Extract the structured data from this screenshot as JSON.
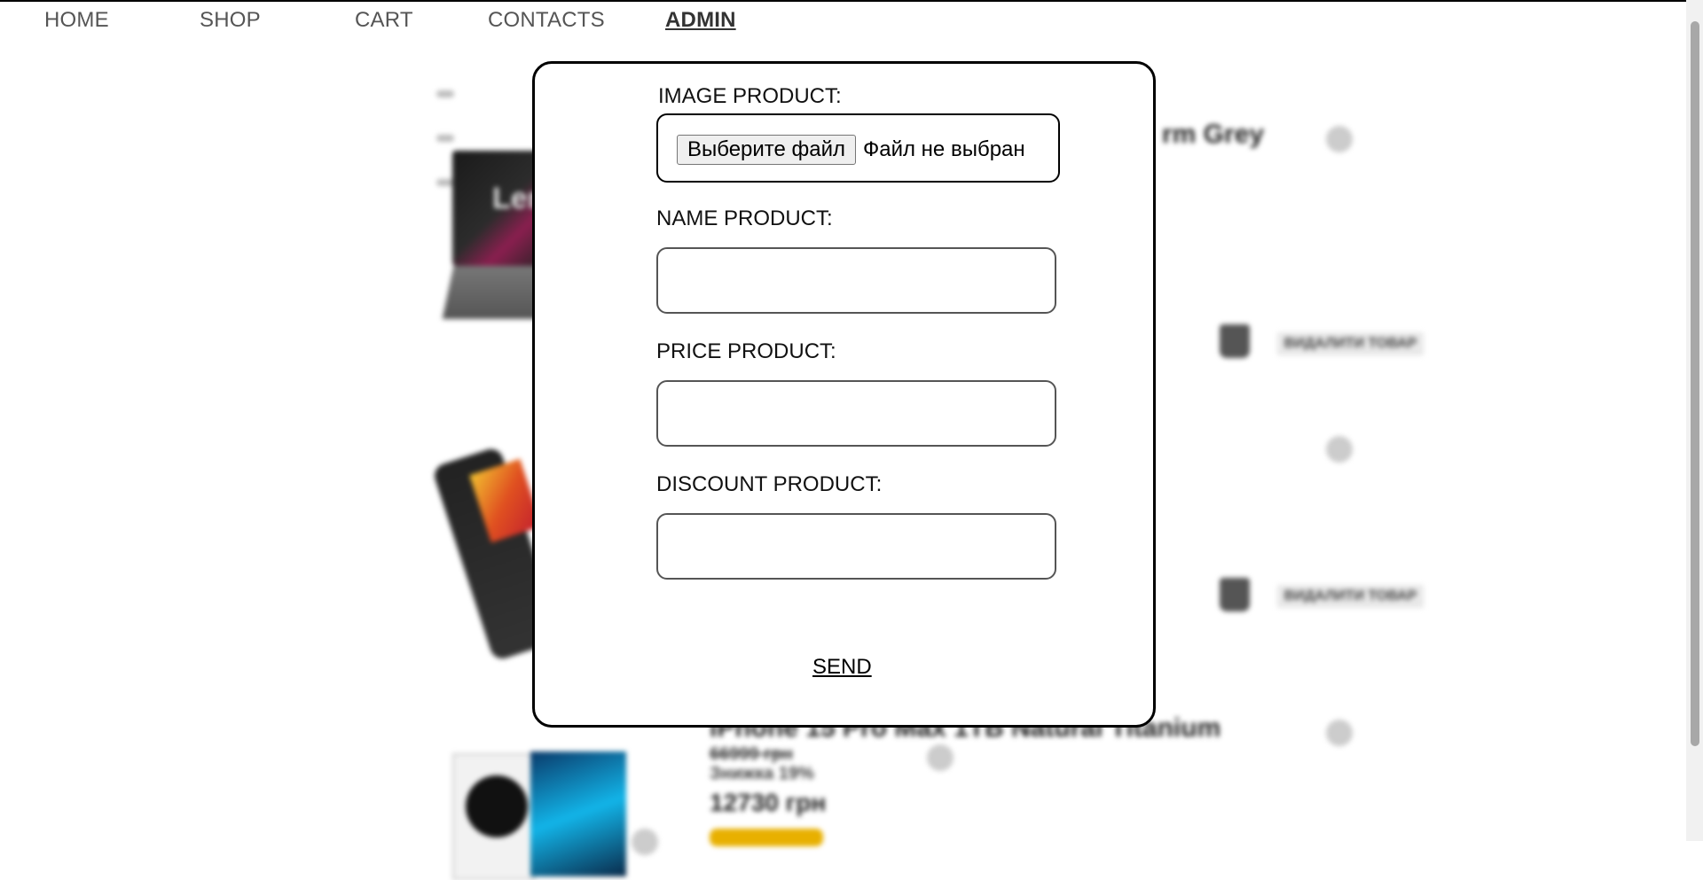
{
  "nav": {
    "home": "HOME",
    "shop": "SHOP",
    "cart": "CART",
    "contacts": "CONTACTS",
    "admin": "ADMIN"
  },
  "background": {
    "product_1_title_fragment": "rm Grey",
    "laptop_brand_fragment": "Ler",
    "product_3_title": "iPhone 15 Pro Max 1TB Natural Titanium",
    "product_3_old_price": "66999 грн",
    "product_3_discount": "Знижка 19%",
    "product_3_price": "12730 грн",
    "delete_label": "ВИДАЛИТИ ТОВАР"
  },
  "form": {
    "image_label": "IMAGE PRODUCT:",
    "file_button": "Выберите файл",
    "file_status": "Файл не выбран",
    "name_label": "NAME PRODUCT:",
    "name_value": "",
    "price_label": "PRICE PRODUCT:",
    "price_value": "",
    "discount_label": "DISCOUNT PRODUCT:",
    "discount_value": "",
    "send_label": "SEND"
  }
}
